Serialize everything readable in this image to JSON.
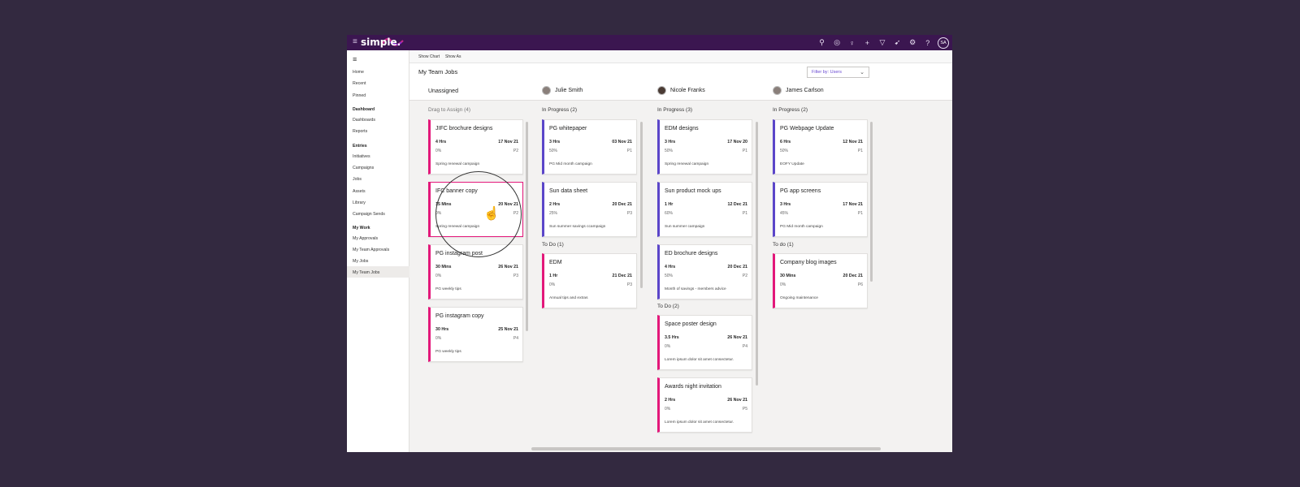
{
  "app": {
    "logo_text": "simple.",
    "topbar_icons": [
      "search-icon",
      "compass-icon",
      "lightbulb-icon",
      "plus-icon",
      "filter-icon",
      "rocket-icon",
      "gear-icon",
      "help-icon"
    ],
    "user_initials": "SA",
    "colors": {
      "topbar": "#3b1650",
      "pink": "#e3187a",
      "purple": "#5b46c9",
      "accent": "#6b4bd2"
    }
  },
  "sidebar": {
    "items": [
      {
        "label": "Home"
      },
      {
        "label": "Recent"
      },
      {
        "label": "Pinned"
      }
    ],
    "section_dashboard": "Dashboard",
    "dashboard_items": [
      {
        "label": "Dashboards"
      },
      {
        "label": "Reports"
      }
    ],
    "section_entries": "Entries",
    "entries_items": [
      {
        "label": "Initiatives"
      },
      {
        "label": "Campaigns"
      },
      {
        "label": "Jobs"
      },
      {
        "label": "Assets"
      },
      {
        "label": "Library"
      },
      {
        "label": "Campaign Sends"
      }
    ],
    "section_mywork": "My Work",
    "mywork_items": [
      {
        "label": "My Approvals"
      },
      {
        "label": "My Team Approvals"
      },
      {
        "label": "My Jobs"
      },
      {
        "label": "My Team Jobs"
      }
    ]
  },
  "cmdbar": {
    "show_chart": "Show Chart",
    "show_as": "Show As"
  },
  "header": {
    "title": "My Team Jobs",
    "filter": "Filter by: Users"
  },
  "columns": [
    {
      "name": "Unassigned"
    },
    {
      "name": "Julie Smith"
    },
    {
      "name": "Nicole Franks"
    },
    {
      "name": "James Carlson"
    }
  ],
  "groups": {
    "unassigned": "Drag to Assign (4)",
    "julie_progress": "In Progress (2)",
    "julie_todo": "To Do (1)",
    "nicole_progress": "In Progress (3)",
    "nicole_todo": "To Do (2)",
    "james_progress": "In Progress (2)",
    "james_todo": "To do (1)"
  },
  "cards": {
    "u1": {
      "title": "JIFC brochure designs",
      "hours": "4 Hrs",
      "date": "17 Nov 21",
      "progress": "0%",
      "priority": "P2",
      "campaign": "Spring renewal campaign"
    },
    "u2": {
      "title": "IFC banner copy",
      "hours": "15 Mins",
      "date": "20 Nov 21",
      "progress": "0%",
      "priority": "P2",
      "campaign": "Spring renewal campaign"
    },
    "u3": {
      "title": "PG instagram post",
      "hours": "30 Mins",
      "date": "26 Nov 21",
      "progress": "0%",
      "priority": "P3",
      "campaign": "PG weekly tips"
    },
    "u4": {
      "title": "PG instagram copy",
      "hours": "30 Hrs",
      "date": "25 Nov 21",
      "progress": "0%",
      "priority": "P4",
      "campaign": "PG weekly tips"
    },
    "j1": {
      "title": "PG whitepaper",
      "hours": "3 Hrs",
      "date": "03 Nov 21",
      "progress": "50%",
      "priority": "P1",
      "campaign": "PG Mid month campaign"
    },
    "j2": {
      "title": "Sun data sheet",
      "hours": "2 Hrs",
      "date": "20 Dec 21",
      "progress": "25%",
      "priority": "P3",
      "campaign": "Sun summer savings ccampaign"
    },
    "j3": {
      "title": "EDM",
      "hours": "1 Hr",
      "date": "21 Dec 21",
      "progress": "0%",
      "priority": "P3",
      "campaign": "Annual tips and extras"
    },
    "n1": {
      "title": "EDM designs",
      "hours": "3 Hrs",
      "date": "17 Nov 20",
      "progress": "50%",
      "priority": "P1",
      "campaign": "Spring renewal campaign"
    },
    "n2": {
      "title": "Sun product mock ups",
      "hours": "1 Hr",
      "date": "12 Dec 21",
      "progress": "60%",
      "priority": "P1",
      "campaign": "Sun summer campaign"
    },
    "n3": {
      "title": "ED brochure designs",
      "hours": "4 Hrs",
      "date": "20 Dec 21",
      "progress": "50%",
      "priority": "P2",
      "campaign": "Month of savings - members advice"
    },
    "n4": {
      "title": "Space poster design",
      "hours": "3.5 Hrs",
      "date": "26 Nov 21",
      "progress": "0%",
      "priority": "P4",
      "campaign": "Lorem ipsum dolor sit amet consectetur."
    },
    "n5": {
      "title": "Awards night invitation",
      "hours": "2 Hrs",
      "date": "26 Nov 21",
      "progress": "0%",
      "priority": "P5",
      "campaign": "Lorem ipsum dolor sit amet consectetur."
    },
    "c1": {
      "title": "PG Webpage Update",
      "hours": "6 Hrs",
      "date": "12 Nov 21",
      "progress": "50%",
      "priority": "P1",
      "campaign": "EOFY Update"
    },
    "c2": {
      "title": "PG app screens",
      "hours": "3 Hrs",
      "date": "17 Nov 21",
      "progress": "45%",
      "priority": "P1",
      "campaign": "PG Mid month campaign"
    },
    "c3": {
      "title": "Company blog images",
      "hours": "30 Mins",
      "date": "20 Dec 21",
      "progress": "0%",
      "priority": "P6",
      "campaign": "Ongoing maintenance"
    }
  }
}
